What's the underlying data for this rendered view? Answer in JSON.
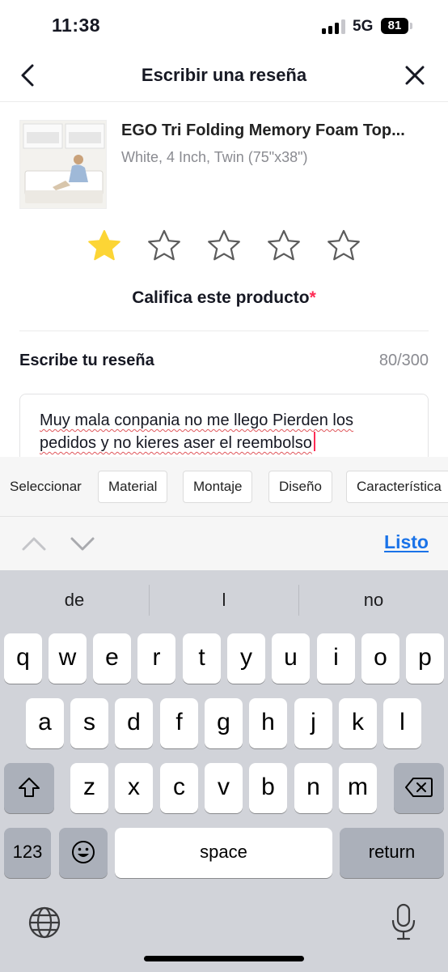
{
  "status": {
    "time": "11:38",
    "network": "5G",
    "battery": "81"
  },
  "header": {
    "title": "Escribir una reseña",
    "back_icon": "chevron-left-icon",
    "close_icon": "close-icon"
  },
  "product": {
    "name": "EGO Tri Folding Memory Foam Top...",
    "variant": "White, 4 Inch, Twin (75\"x38\")"
  },
  "rating": {
    "value": 1,
    "max": 5,
    "label": "Califica este producto",
    "required_mark": "*",
    "filled_color": "#fcd535"
  },
  "review": {
    "label": "Escribe tu reseña",
    "count": "80/300",
    "text": "Muy mala conpania no me llego Pierden los pedidos y no kieres aser el reembolso"
  },
  "chips": {
    "label": "Seleccionar",
    "items": [
      "Material",
      "Montaje",
      "Diseño",
      "Característica"
    ]
  },
  "accessory": {
    "done_label": "Listo"
  },
  "keyboard": {
    "suggestions": [
      "de",
      "l",
      "no"
    ],
    "row1": [
      "q",
      "w",
      "e",
      "r",
      "t",
      "y",
      "u",
      "i",
      "o",
      "p"
    ],
    "row2": [
      "a",
      "s",
      "d",
      "f",
      "g",
      "h",
      "j",
      "k",
      "l"
    ],
    "row3": [
      "z",
      "x",
      "c",
      "v",
      "b",
      "n",
      "m"
    ],
    "numbers_label": "123",
    "space_label": "space",
    "return_label": "return"
  }
}
